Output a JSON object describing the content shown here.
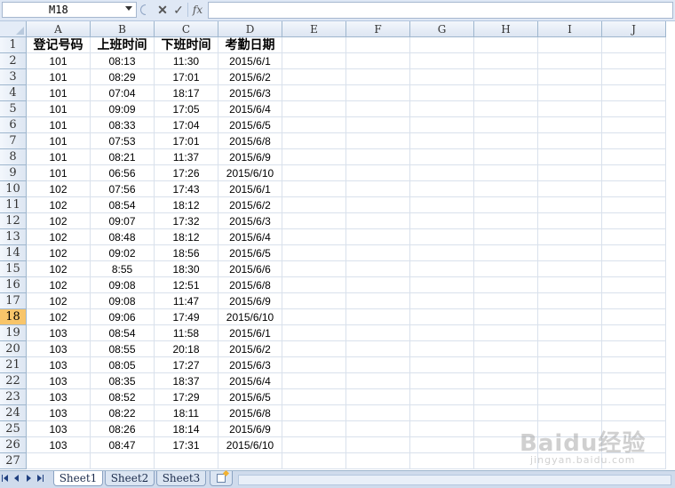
{
  "formula_bar": {
    "name_box": "M18",
    "cancel_icon": "x-icon",
    "enter_icon": "check-icon",
    "fx_label": "fx",
    "formula": ""
  },
  "columns": [
    "A",
    "B",
    "C",
    "D",
    "E",
    "F",
    "G",
    "H",
    "I",
    "J"
  ],
  "selected_row": "18",
  "header_row": [
    "登记号码",
    "上班时间",
    "下班时间",
    "考勤日期"
  ],
  "rows": [
    [
      "101",
      "08:13",
      "11:30",
      "2015/6/1"
    ],
    [
      "101",
      "08:29",
      "17:01",
      "2015/6/2"
    ],
    [
      "101",
      "07:04",
      "18:17",
      "2015/6/3"
    ],
    [
      "101",
      "09:09",
      "17:05",
      "2015/6/4"
    ],
    [
      "101",
      "08:33",
      "17:04",
      "2015/6/5"
    ],
    [
      "101",
      "07:53",
      "17:01",
      "2015/6/8"
    ],
    [
      "101",
      "08:21",
      "11:37",
      "2015/6/9"
    ],
    [
      "101",
      "06:56",
      "17:26",
      "2015/6/10"
    ],
    [
      "102",
      "07:56",
      "17:43",
      "2015/6/1"
    ],
    [
      "102",
      "08:54",
      "18:12",
      "2015/6/2"
    ],
    [
      "102",
      "09:07",
      "17:32",
      "2015/6/3"
    ],
    [
      "102",
      "08:48",
      "18:12",
      "2015/6/4"
    ],
    [
      "102",
      "09:02",
      "18:56",
      "2015/6/5"
    ],
    [
      "102",
      "8:55",
      "18:30",
      "2015/6/6"
    ],
    [
      "102",
      "09:08",
      "12:51",
      "2015/6/8"
    ],
    [
      "102",
      "09:08",
      "11:47",
      "2015/6/9"
    ],
    [
      "102",
      "09:06",
      "17:49",
      "2015/6/10"
    ],
    [
      "103",
      "08:54",
      "11:58",
      "2015/6/1"
    ],
    [
      "103",
      "08:55",
      "20:18",
      "2015/6/2"
    ],
    [
      "103",
      "08:05",
      "17:27",
      "2015/6/3"
    ],
    [
      "103",
      "08:35",
      "18:37",
      "2015/6/4"
    ],
    [
      "103",
      "08:52",
      "17:29",
      "2015/6/5"
    ],
    [
      "103",
      "08:22",
      "18:11",
      "2015/6/8"
    ],
    [
      "103",
      "08:26",
      "18:14",
      "2015/6/9"
    ],
    [
      "103",
      "08:47",
      "17:31",
      "2015/6/10"
    ]
  ],
  "row_numbers": [
    "1",
    "2",
    "3",
    "4",
    "5",
    "6",
    "7",
    "8",
    "9",
    "10",
    "11",
    "12",
    "13",
    "14",
    "15",
    "16",
    "17",
    "18",
    "19",
    "20",
    "21",
    "22",
    "23",
    "24",
    "25",
    "26",
    "27"
  ],
  "sheet_tabs": [
    "Sheet1",
    "Sheet2",
    "Sheet3"
  ],
  "active_sheet": "Sheet1",
  "watermark": {
    "logo": "Baidu经验",
    "sub": "jingyan.baidu.com"
  }
}
